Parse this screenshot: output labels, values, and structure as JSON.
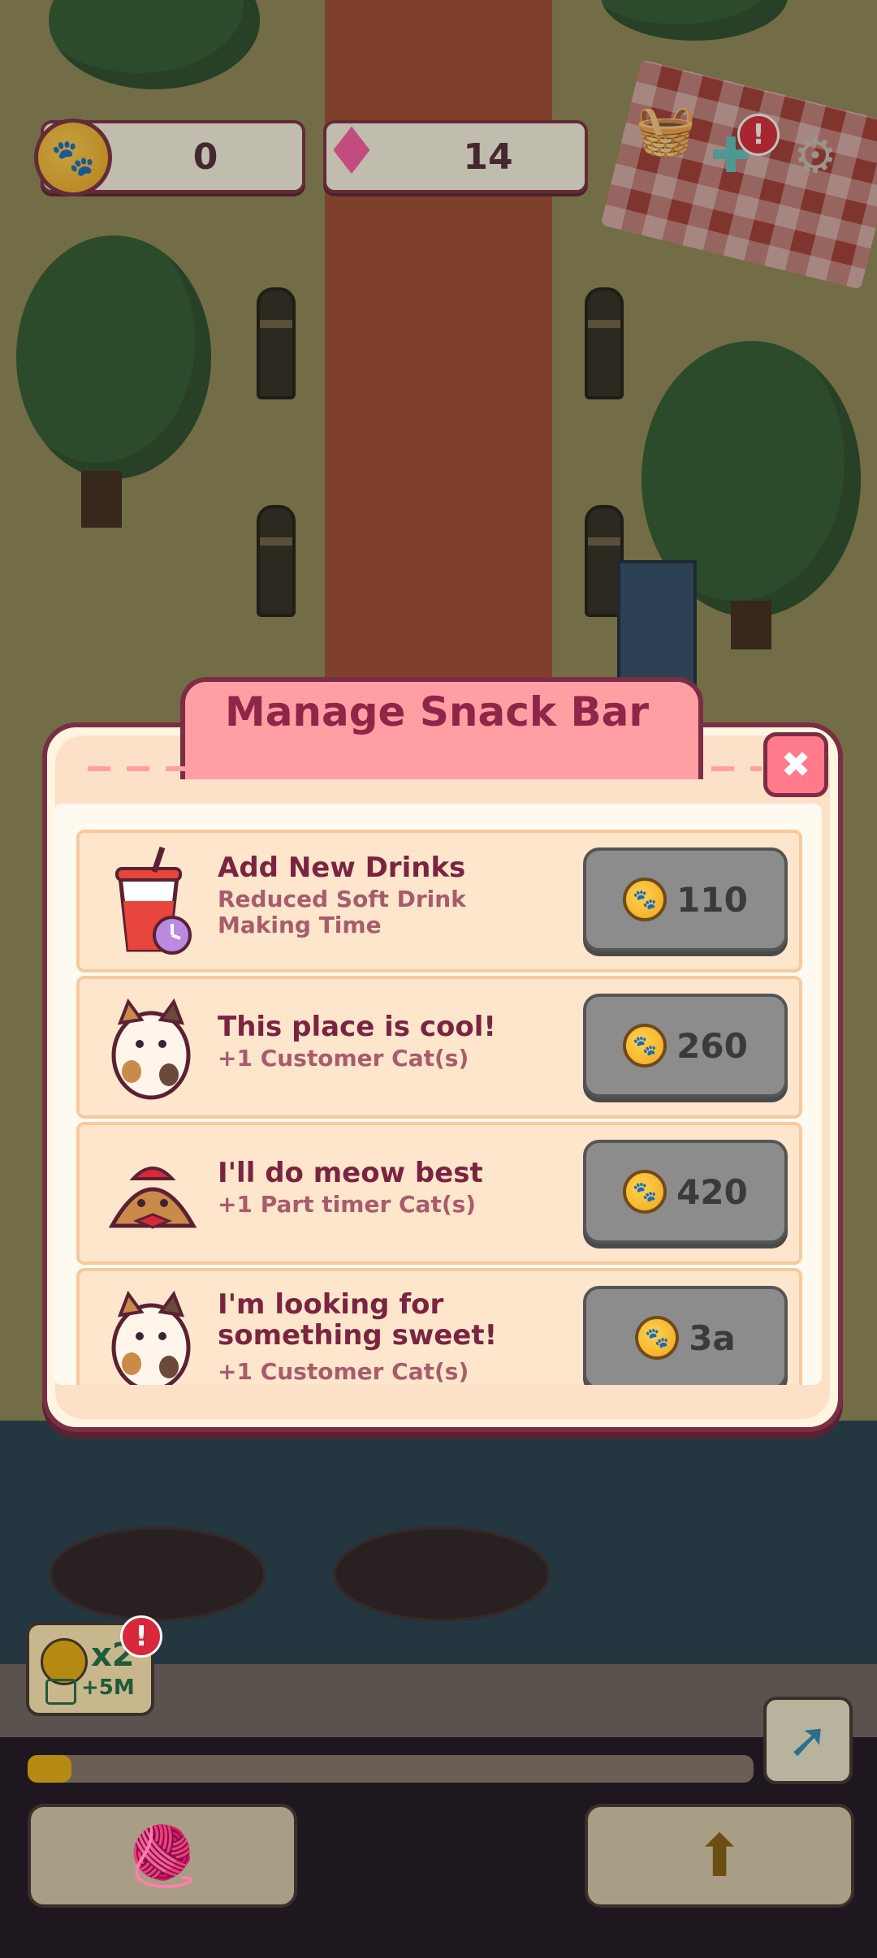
{
  "hud": {
    "coins": "0",
    "gems": "14",
    "alert_badge": "!"
  },
  "modal": {
    "title": "Manage Snack Bar",
    "close_icon": "close-icon",
    "items": [
      {
        "title": "Add New Drinks",
        "subtitle": "Reduced Soft Drink Making Time",
        "price": "110",
        "icon": "soda-cup-icon"
      },
      {
        "title": "This place is cool!",
        "subtitle": "+1 Customer Cat(s)",
        "price": "260",
        "icon": "calico-cat-icon"
      },
      {
        "title": "I'll do meow best",
        "subtitle": "+1 Part timer Cat(s)",
        "price": "420",
        "icon": "worker-cat-icon"
      },
      {
        "title": "I'm looking for something sweet!",
        "subtitle": "+1 Customer Cat(s)",
        "price": "3a",
        "icon": "calico-cat-icon"
      }
    ]
  },
  "bottom": {
    "boost_multiplier": "x2",
    "boost_reward": "+5M",
    "boost_badge": "!",
    "progress": 0.06
  },
  "colors": {
    "accent": "#ff9fa3",
    "title": "#8f2648",
    "border": "#7a2e44"
  }
}
